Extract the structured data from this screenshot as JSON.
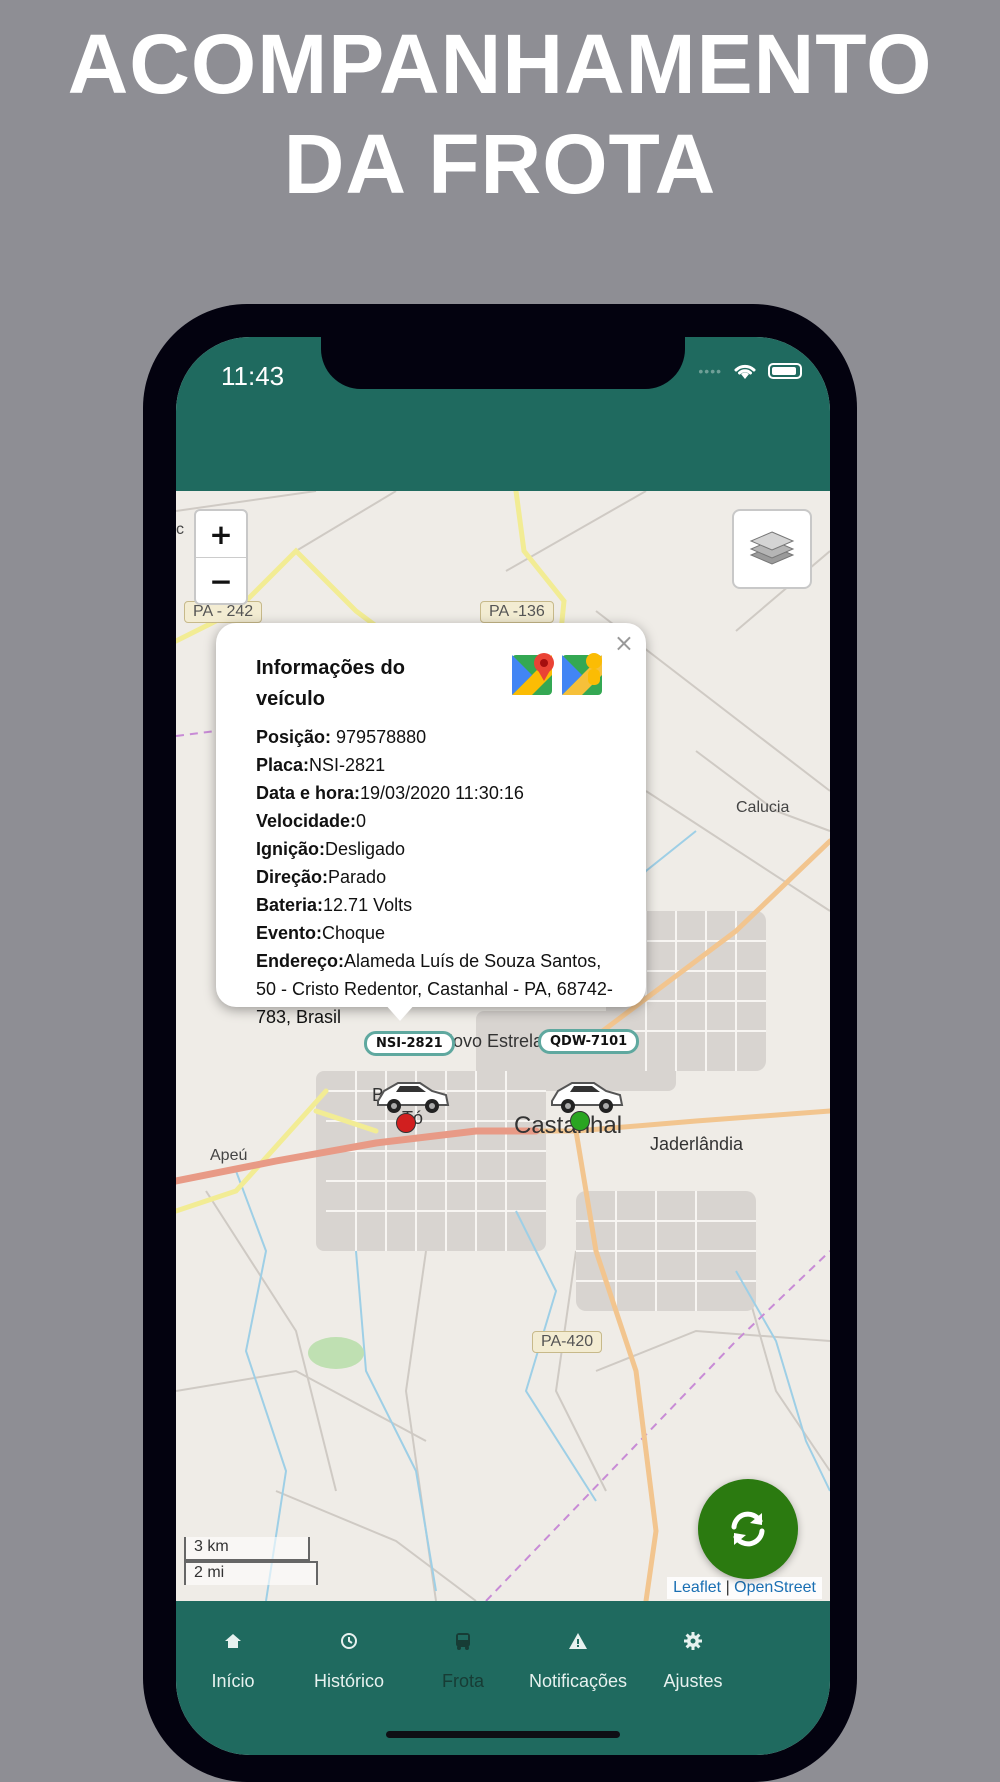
{
  "headline": {
    "line1": "ACOMPANHAMENTO",
    "line2": "DA FROTA"
  },
  "status_bar": {
    "time": "11:43",
    "signal_icon": "signal-dots-icon",
    "wifi_icon": "wifi-icon",
    "battery_icon": "battery-icon"
  },
  "map": {
    "zoom_in": "+",
    "zoom_out": "−",
    "layers_icon": "layers-icon",
    "roads": [
      "PA - 242",
      "PA -136",
      "PA-420"
    ],
    "places": [
      "Calucia",
      "Apeú",
      "Castanhal",
      "Jaderlândia",
      "Novo Estrela",
      "Tó",
      "B"
    ],
    "scale": {
      "km": "3 km",
      "mi": "2 mi"
    },
    "attribution": {
      "leaflet": "Leaflet",
      "separator": "|",
      "osm": "OpenStreet"
    }
  },
  "popup": {
    "title": "Informações do veículo",
    "close": "×",
    "map_icons": [
      "google-maps-icon",
      "street-view-icon"
    ],
    "rows": [
      {
        "label": "Posição:",
        "value": " 979578880"
      },
      {
        "label": "Placa:",
        "value": "NSI-2821"
      },
      {
        "label": "Data e hora:",
        "value": "19/03/2020 11:30:16"
      },
      {
        "label": "Velocidade:",
        "value": "0"
      },
      {
        "label": "Ignição:",
        "value": "Desligado"
      },
      {
        "label": "Direção:",
        "value": "Parado"
      },
      {
        "label": "Bateria:",
        "value": "12.71 Volts"
      },
      {
        "label": "Evento:",
        "value": "Choque"
      },
      {
        "label": "Endereço:",
        "value": "Alameda Luís de Souza Santos, 50 - Cristo Redentor, Castanhal - PA, 68742-783, Brasil"
      }
    ]
  },
  "vehicles": [
    {
      "plate": "NSI-2821",
      "status_color": "#d11f1f"
    },
    {
      "plate": "QDW-7101",
      "status_color": "#2aa521"
    }
  ],
  "fab": {
    "icon": "refresh-icon"
  },
  "tabs": [
    {
      "label": "Início",
      "icon": "home-icon",
      "active": false
    },
    {
      "label": "Histórico",
      "icon": "history-icon",
      "active": false
    },
    {
      "label": "Frota",
      "icon": "bus-icon",
      "active": true
    },
    {
      "label": "Notificações",
      "icon": "warning-icon",
      "active": false
    },
    {
      "label": "Ajustes",
      "icon": "gear-icon",
      "active": false
    }
  ],
  "colors": {
    "primary": "#1f6a5f",
    "fab": "#2b7a10",
    "plate_border": "#5fa89f"
  }
}
